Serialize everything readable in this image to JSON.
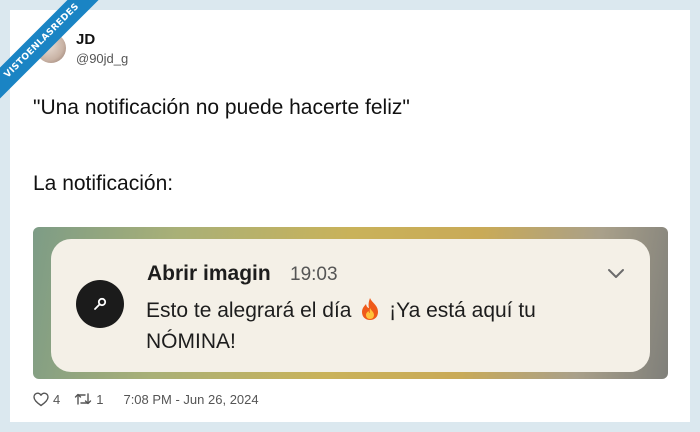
{
  "watermark": {
    "text": "VISTOENLASREDES"
  },
  "author": {
    "name": "JD",
    "handle": "@90jd_g"
  },
  "tweet": {
    "line1": "\"Una notificación no puede hacerte feliz\"",
    "line2": "La notificación:"
  },
  "notification": {
    "app": "Abrir imagin",
    "time": "19:03",
    "body_before": "Esto te alegrará el día",
    "body_after": "¡Ya está aquí tu NÓMINA!"
  },
  "footer": {
    "likes": "4",
    "retweets": "1",
    "timestamp": "7:08 PM - Jun 26, 2024"
  }
}
